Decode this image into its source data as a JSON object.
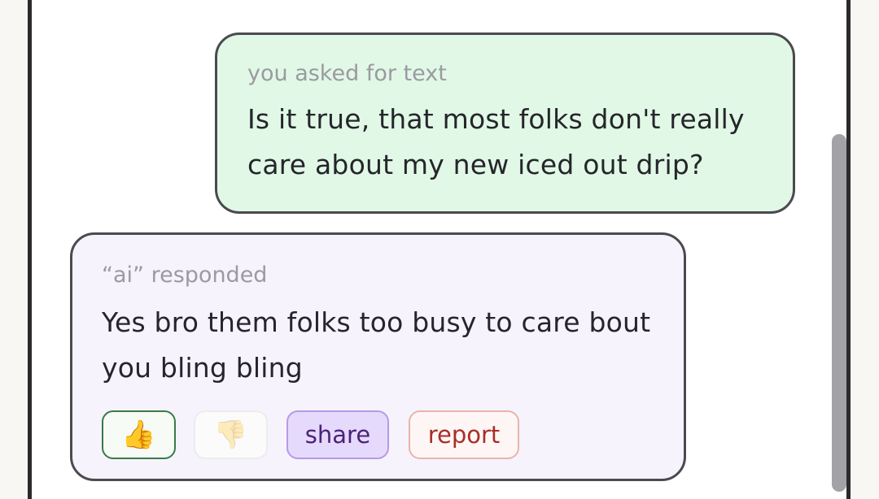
{
  "conversation": {
    "user_message": {
      "caption": "you asked for text",
      "text": "Is it true, that most folks don't really care about my new iced out drip?"
    },
    "ai_message": {
      "caption": "“ai” responded",
      "text": "Yes bro them folks too busy to care bout you bling bling"
    }
  },
  "actions": {
    "thumbs_up_glyph": "👍",
    "thumbs_down_glyph": "👎",
    "share_label": "share",
    "report_label": "report"
  },
  "icons": {
    "thumbs_up": "thumbs-up-icon",
    "thumbs_down": "thumbs-down-icon"
  },
  "colors": {
    "user_bubble": "#e1f8e6",
    "ai_bubble": "#f6f3fd",
    "share_bg": "#e6dafc",
    "report_text": "#a92e27",
    "thumbs_up_border": "#3a7a48"
  }
}
